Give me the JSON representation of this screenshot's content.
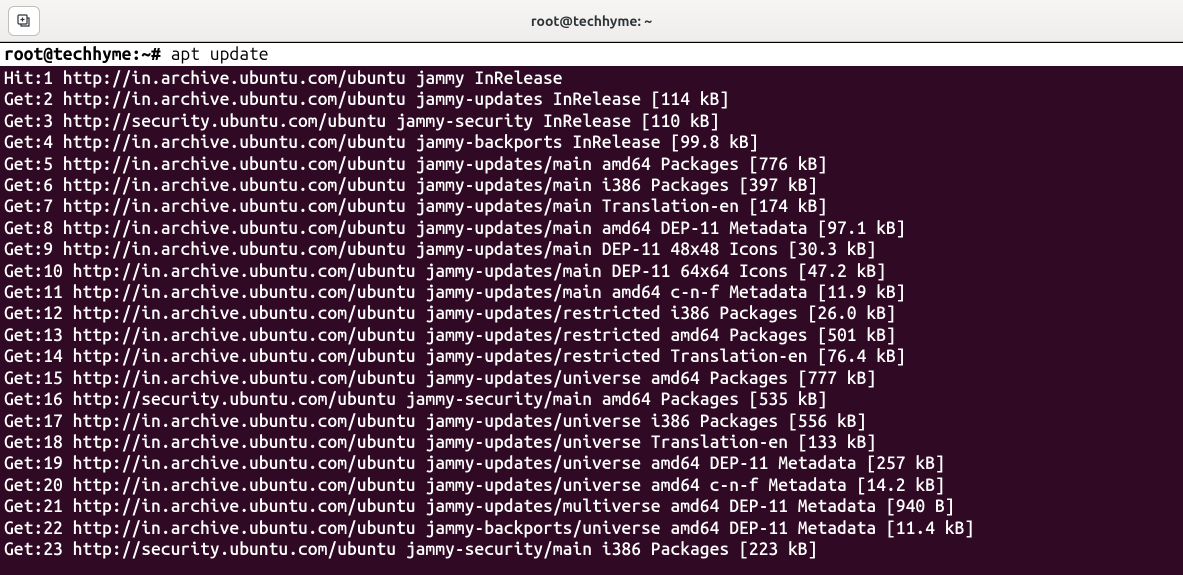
{
  "window": {
    "title": "root@techhyme: ~"
  },
  "prompt": {
    "text": "root@techhyme:~# ",
    "command": "apt update"
  },
  "output_lines": [
    "Hit:1 http://in.archive.ubuntu.com/ubuntu jammy InRelease",
    "Get:2 http://in.archive.ubuntu.com/ubuntu jammy-updates InRelease [114 kB]",
    "Get:3 http://security.ubuntu.com/ubuntu jammy-security InRelease [110 kB]",
    "Get:4 http://in.archive.ubuntu.com/ubuntu jammy-backports InRelease [99.8 kB]",
    "Get:5 http://in.archive.ubuntu.com/ubuntu jammy-updates/main amd64 Packages [776 kB]",
    "Get:6 http://in.archive.ubuntu.com/ubuntu jammy-updates/main i386 Packages [397 kB]",
    "Get:7 http://in.archive.ubuntu.com/ubuntu jammy-updates/main Translation-en [174 kB]",
    "Get:8 http://in.archive.ubuntu.com/ubuntu jammy-updates/main amd64 DEP-11 Metadata [97.1 kB]",
    "Get:9 http://in.archive.ubuntu.com/ubuntu jammy-updates/main DEP-11 48x48 Icons [30.3 kB]",
    "Get:10 http://in.archive.ubuntu.com/ubuntu jammy-updates/main DEP-11 64x64 Icons [47.2 kB]",
    "Get:11 http://in.archive.ubuntu.com/ubuntu jammy-updates/main amd64 c-n-f Metadata [11.9 kB]",
    "Get:12 http://in.archive.ubuntu.com/ubuntu jammy-updates/restricted i386 Packages [26.0 kB]",
    "Get:13 http://in.archive.ubuntu.com/ubuntu jammy-updates/restricted amd64 Packages [501 kB]",
    "Get:14 http://in.archive.ubuntu.com/ubuntu jammy-updates/restricted Translation-en [76.4 kB]",
    "Get:15 http://in.archive.ubuntu.com/ubuntu jammy-updates/universe amd64 Packages [777 kB]",
    "Get:16 http://security.ubuntu.com/ubuntu jammy-security/main amd64 Packages [535 kB]",
    "Get:17 http://in.archive.ubuntu.com/ubuntu jammy-updates/universe i386 Packages [556 kB]",
    "Get:18 http://in.archive.ubuntu.com/ubuntu jammy-updates/universe Translation-en [133 kB]",
    "Get:19 http://in.archive.ubuntu.com/ubuntu jammy-updates/universe amd64 DEP-11 Metadata [257 kB]",
    "Get:20 http://in.archive.ubuntu.com/ubuntu jammy-updates/universe amd64 c-n-f Metadata [14.2 kB]",
    "Get:21 http://in.archive.ubuntu.com/ubuntu jammy-updates/multiverse amd64 DEP-11 Metadata [940 B]",
    "Get:22 http://in.archive.ubuntu.com/ubuntu jammy-backports/universe amd64 DEP-11 Metadata [11.4 kB]",
    "Get:23 http://security.ubuntu.com/ubuntu jammy-security/main i386 Packages [223 kB]"
  ]
}
